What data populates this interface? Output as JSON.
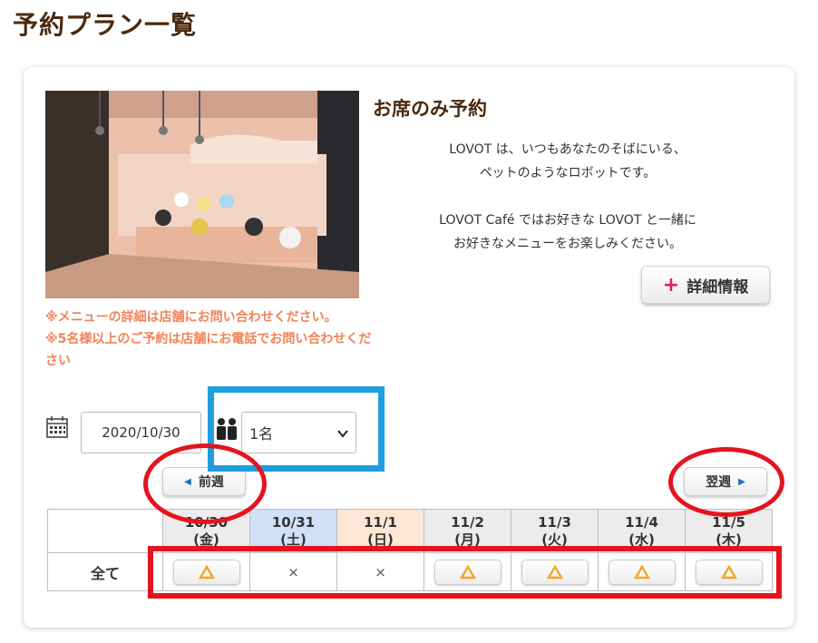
{
  "page": {
    "title": "予約プラン一覧"
  },
  "plan": {
    "title": "お席のみ予約",
    "description": [
      "LOVOT は、いつもあなたのそばにいる、",
      "ペットのようなロボットです。",
      "LOVOT Café ではお好きな LOVOT と一緒に",
      "お好きなメニューをお楽しみください。"
    ],
    "detail_button": "詳細情報",
    "notes": [
      "※メニューの詳細は店舗にお問い合わせください。",
      "※5名様以上のご予約は店舗にお電話でお問い合わせください"
    ]
  },
  "booking": {
    "date": "2020/10/30",
    "party_size": "1名"
  },
  "navigation": {
    "prev_week": "前週",
    "next_week": "翌週"
  },
  "schedule": {
    "days": [
      {
        "date": "10/30",
        "weekday": "(金)"
      },
      {
        "date": "10/31",
        "weekday": "(土)"
      },
      {
        "date": "11/1",
        "weekday": "(日)"
      },
      {
        "date": "11/2",
        "weekday": "(月)"
      },
      {
        "date": "11/3",
        "weekday": "(火)"
      },
      {
        "date": "11/4",
        "weekday": "(水)"
      },
      {
        "date": "11/5",
        "weekday": "(木)"
      }
    ],
    "row_label": "全て",
    "availability": [
      "△",
      "×",
      "×",
      "△",
      "△",
      "△",
      "△"
    ]
  },
  "colors": {
    "title_brown": "#4a2a0e",
    "note_orange": "#f0825a",
    "plus_pink": "#e0215b",
    "highlight_red": "#e4141e",
    "highlight_blue": "#1e9ee0",
    "triangle_orange": "#f5a623"
  },
  "icons": {
    "calendar": "calendar-icon",
    "people": "people-icon",
    "plus": "plus-icon",
    "prev": "triangle-left-icon",
    "next": "triangle-right-icon",
    "select": "chevron-down-icon"
  }
}
